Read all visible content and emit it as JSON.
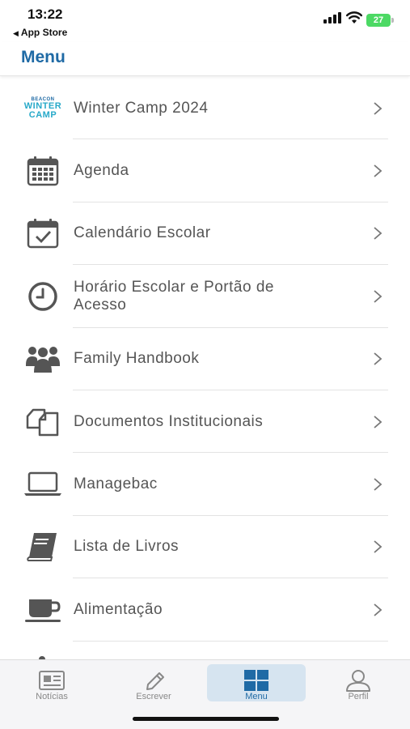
{
  "status": {
    "time": "13:22",
    "back_label": "App Store",
    "battery": "27"
  },
  "header": {
    "title": "Menu"
  },
  "colors": {
    "accent": "#1f6aa5",
    "icon_gray": "#555555",
    "battery": "#4cd964"
  },
  "menu": {
    "items": [
      {
        "label": "Winter Camp 2024",
        "icon": "winter-camp-logo",
        "logo_text": [
          "BEACON",
          "WINTER",
          "CAMP"
        ]
      },
      {
        "label": "Agenda",
        "icon": "calendar-grid-icon"
      },
      {
        "label": "Calendário Escolar",
        "icon": "calendar-check-icon"
      },
      {
        "label": "Horário Escolar e Portão de Acesso",
        "icon": "clock-icon"
      },
      {
        "label": "Family Handbook",
        "icon": "people-group-icon"
      },
      {
        "label": "Documentos Institucionais",
        "icon": "documents-icon"
      },
      {
        "label": "Managebac",
        "icon": "laptop-icon"
      },
      {
        "label": "Lista de Livros",
        "icon": "book-icon"
      },
      {
        "label": "Alimentação",
        "icon": "coffee-cup-icon"
      }
    ]
  },
  "tabs": [
    {
      "label": "Notícias",
      "icon": "newspaper-icon",
      "active": false
    },
    {
      "label": "Escrever",
      "icon": "pencil-icon",
      "active": false
    },
    {
      "label": "Menu",
      "icon": "grid-icon",
      "active": true
    },
    {
      "label": "Perfil",
      "icon": "person-icon",
      "active": false
    }
  ]
}
